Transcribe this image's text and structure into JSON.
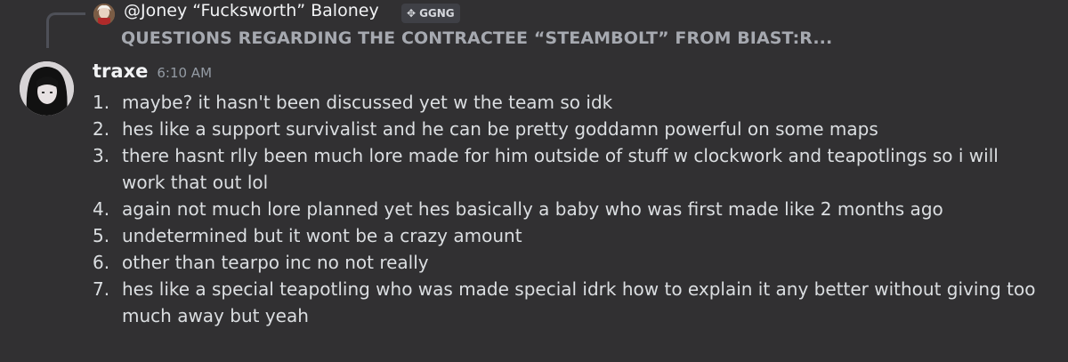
{
  "reply": {
    "author": "@Joney “Fucksworth” Baloney",
    "tag_icon": "✥",
    "tag": "GGNG",
    "preview": "QUESTIONS REGARDING THE CONTRACTEE “STEAMBOLT” FROM BIAST:R..."
  },
  "message": {
    "author": "traxe",
    "time": "6:10 AM",
    "items": [
      {
        "num": "1.",
        "text": "maybe? it hasn't been discussed yet w the team so idk"
      },
      {
        "num": "2.",
        "text": "hes like a support survivalist and he can be pretty goddamn powerful on some maps"
      },
      {
        "num": "3.",
        "text": "there hasnt rlly been much lore made for him outside of stuff w clockwork and teapotlings so i will work that out lol"
      },
      {
        "num": "4.",
        "text": "again not much lore planned yet hes basically a baby who was first made like 2 months ago"
      },
      {
        "num": "5.",
        "text": "undetermined but it wont be a crazy amount"
      },
      {
        "num": "6.",
        "text": "other than tearpo inc no not really"
      },
      {
        "num": "7.",
        "text": "hes like a special teapotling who was made special idrk how to explain it any better without giving too much away but yeah"
      }
    ]
  }
}
